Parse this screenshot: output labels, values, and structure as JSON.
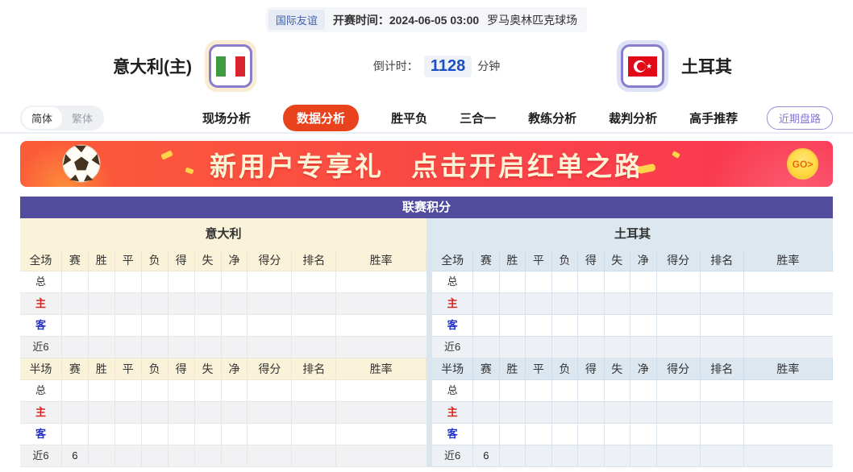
{
  "match_header": {
    "league_badge": "国际友谊",
    "kickoff_label": "开赛时间：",
    "kickoff_time": "2024-06-05 03:00",
    "venue": "罗马奥林匹克球场"
  },
  "teams": {
    "home": {
      "name": "意大利(主)",
      "flag": "italy-flag"
    },
    "away": {
      "name": "土耳其",
      "flag": "turkey-flag"
    },
    "countdown": {
      "label": "倒计时：",
      "value": "1128",
      "unit": "分钟"
    }
  },
  "nav": {
    "lang_toggle": {
      "simplified": "简体",
      "traditional": "繁体"
    },
    "tabs": [
      {
        "label": "现场分析",
        "active": false
      },
      {
        "label": "数据分析",
        "active": true
      },
      {
        "label": "胜平负",
        "active": false
      },
      {
        "label": "三合一",
        "active": false
      },
      {
        "label": "教练分析",
        "active": false
      },
      {
        "label": "裁判分析",
        "active": false
      },
      {
        "label": "高手推荐",
        "active": false
      }
    ],
    "recent_trends_button": "近期盘路"
  },
  "banner": {
    "text1": "新用户专享礼",
    "text2": "点击开启红单之路",
    "go_label": "GO>"
  },
  "league_table": {
    "title": "联赛积分",
    "stat_columns": [
      "赛",
      "胜",
      "平",
      "负",
      "得",
      "失",
      "净",
      "得分",
      "排名",
      "胜率"
    ],
    "home": {
      "name": "意大利",
      "sections": [
        {
          "first_col": "全场",
          "rows": [
            {
              "label": "总",
              "values": [
                "",
                "",
                "",
                "",
                "",
                "",
                "",
                "",
                "",
                ""
              ]
            },
            {
              "label": "主",
              "values": [
                "",
                "",
                "",
                "",
                "",
                "",
                "",
                "",
                "",
                ""
              ]
            },
            {
              "label": "客",
              "values": [
                "",
                "",
                "",
                "",
                "",
                "",
                "",
                "",
                "",
                ""
              ]
            },
            {
              "label": "近6",
              "values": [
                "",
                "",
                "",
                "",
                "",
                "",
                "",
                "",
                "",
                ""
              ]
            }
          ]
        },
        {
          "first_col": "半场",
          "rows": [
            {
              "label": "总",
              "values": [
                "",
                "",
                "",
                "",
                "",
                "",
                "",
                "",
                "",
                ""
              ]
            },
            {
              "label": "主",
              "values": [
                "",
                "",
                "",
                "",
                "",
                "",
                "",
                "",
                "",
                ""
              ]
            },
            {
              "label": "客",
              "values": [
                "",
                "",
                "",
                "",
                "",
                "",
                "",
                "",
                "",
                ""
              ]
            },
            {
              "label": "近6",
              "values": [
                "6",
                "",
                "",
                "",
                "",
                "",
                "",
                "",
                "",
                ""
              ]
            }
          ]
        }
      ]
    },
    "away": {
      "name": "土耳其",
      "sections": [
        {
          "first_col": "全场",
          "rows": [
            {
              "label": "总",
              "values": [
                "",
                "",
                "",
                "",
                "",
                "",
                "",
                "",
                "",
                ""
              ]
            },
            {
              "label": "主",
              "values": [
                "",
                "",
                "",
                "",
                "",
                "",
                "",
                "",
                "",
                ""
              ]
            },
            {
              "label": "客",
              "values": [
                "",
                "",
                "",
                "",
                "",
                "",
                "",
                "",
                "",
                ""
              ]
            },
            {
              "label": "近6",
              "values": [
                "",
                "",
                "",
                "",
                "",
                "",
                "",
                "",
                "",
                ""
              ]
            }
          ]
        },
        {
          "first_col": "半场",
          "rows": [
            {
              "label": "总",
              "values": [
                "",
                "",
                "",
                "",
                "",
                "",
                "",
                "",
                "",
                ""
              ]
            },
            {
              "label": "主",
              "values": [
                "",
                "",
                "",
                "",
                "",
                "",
                "",
                "",
                "",
                ""
              ]
            },
            {
              "label": "客",
              "values": [
                "",
                "",
                "",
                "",
                "",
                "",
                "",
                "",
                "",
                ""
              ]
            },
            {
              "label": "近6",
              "values": [
                "6",
                "",
                "",
                "",
                "",
                "",
                "",
                "",
                "",
                ""
              ]
            }
          ]
        }
      ]
    }
  },
  "colors": {
    "accent_red": "#e8431d",
    "table_purple": "#514c9e",
    "home_tint": "#fbf2da",
    "away_tint": "#dce7f0",
    "home_red": "#d8241e",
    "away_blue": "#2230cc",
    "countdown_blue": "#1c4fc4",
    "badge_blue": "#4062b0",
    "banner_g1": "#fb5c38",
    "banner_g2": "#fa3553",
    "banner_cream": "#fdf3d6",
    "go_yellow": "#ffd93e",
    "frame_purple": "#8a7ccc"
  }
}
